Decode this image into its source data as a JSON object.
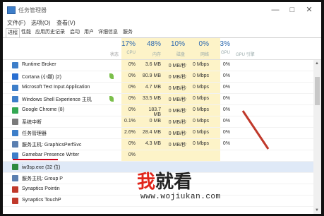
{
  "window": {
    "title": "任务管理器",
    "controls": [
      "—",
      "□",
      "✕"
    ]
  },
  "menubar": [
    "文件(F)",
    "选项(O)",
    "查看(V)"
  ],
  "tabs": [
    "进程",
    "性能",
    "应用历史记录",
    "启动",
    "用户",
    "详细信息",
    "服务"
  ],
  "header": {
    "cpu_pct": "17%",
    "cpu": "CPU",
    "mem_pct": "48%",
    "mem": "内存",
    "disk_pct": "10%",
    "disk": "磁盘",
    "net_pct": "0%",
    "net": "网络",
    "gpu_pct": "3%",
    "gpu": "GPU",
    "gpu_engine": "GPU 引擎",
    "status": "状态"
  },
  "rows": [
    {
      "name": "Runtime Broker",
      "cpu": "0%",
      "mem": "3.6 MB",
      "disk": "0 MB/秒",
      "net": "0 Mbps",
      "gpu": "0%",
      "icon_color": "#3d7ec9",
      "leaf": false
    },
    {
      "name": "Cortana (小娜) (2)",
      "cpu": "0%",
      "mem": "80.9 MB",
      "disk": "0 MB/秒",
      "net": "0 Mbps",
      "gpu": "0%",
      "icon_color": "#2a6fd1",
      "leaf": true
    },
    {
      "name": "Microsoft Text Input Application",
      "cpu": "0%",
      "mem": "4.7 MB",
      "disk": "0 MB/秒",
      "net": "0 Mbps",
      "gpu": "0%",
      "icon_color": "#3d7ec9",
      "leaf": false
    },
    {
      "name": "Windows Shell Experience 主机",
      "cpu": "0%",
      "mem": "33.5 MB",
      "disk": "0 MB/秒",
      "net": "0 Mbps",
      "gpu": "0%",
      "icon_color": "#3d7ec9",
      "leaf": true
    },
    {
      "name": "Google Chrome (8)",
      "cpu": "0%",
      "mem": "183.7 MB",
      "disk": "0 MB/秒",
      "net": "0 Mbps",
      "gpu": "0%",
      "icon_color": "#34a853",
      "leaf": false
    },
    {
      "name": "系统中断",
      "cpu": "0.1%",
      "mem": "0 MB",
      "disk": "0 MB/秒",
      "net": "0 Mbps",
      "gpu": "0%",
      "icon_color": "#7a7a7a",
      "leaf": false
    },
    {
      "name": "任务管理器",
      "cpu": "2.6%",
      "mem": "28.4 MB",
      "disk": "0 MB/秒",
      "net": "0 Mbps",
      "gpu": "0%",
      "icon_color": "#3d7ec9",
      "leaf": false
    },
    {
      "name": "服务主机: GraphicsPerfSvc",
      "cpu": "0%",
      "mem": "4.3 MB",
      "disk": "0 MB/秒",
      "net": "0 Mbps",
      "gpu": "0%",
      "icon_color": "#5a7fb0",
      "leaf": false
    },
    {
      "name": "Gamebar Presence Writer",
      "cpu": "0%",
      "mem": "",
      "disk": "",
      "net": "",
      "gpu": "",
      "icon_color": "#3d7ec9",
      "leaf": false
    },
    {
      "name": "iw3sp.exe (32 位)",
      "cpu": "",
      "mem": "",
      "disk": "",
      "net": "",
      "gpu": "",
      "icon_color": "#2d8a3e",
      "leaf": false
    },
    {
      "name": "服务主机: Group P",
      "cpu": "",
      "mem": "",
      "disk": "",
      "net": "",
      "gpu": "",
      "icon_color": "#5a7fb0",
      "leaf": false
    },
    {
      "name": "Synaptics Pointin",
      "cpu": "",
      "mem": "",
      "disk": "",
      "net": "",
      "gpu": "",
      "icon_color": "#c0392b",
      "leaf": false
    },
    {
      "name": "Synaptics TouchP",
      "cpu": "",
      "mem": "",
      "disk": "",
      "net": "",
      "gpu": "",
      "icon_color": "#c0392b",
      "leaf": false
    }
  ],
  "watermark": {
    "char1": "我",
    "char23": "就看",
    "url": "www.wojiukan.com",
    "color1": "#e1251b",
    "color2": "#222222"
  },
  "colors": {
    "highlight": "#fdf3c8",
    "accent": "#2e6ab0",
    "arrow": "#c0392b",
    "selected": "#dfe9f7"
  }
}
